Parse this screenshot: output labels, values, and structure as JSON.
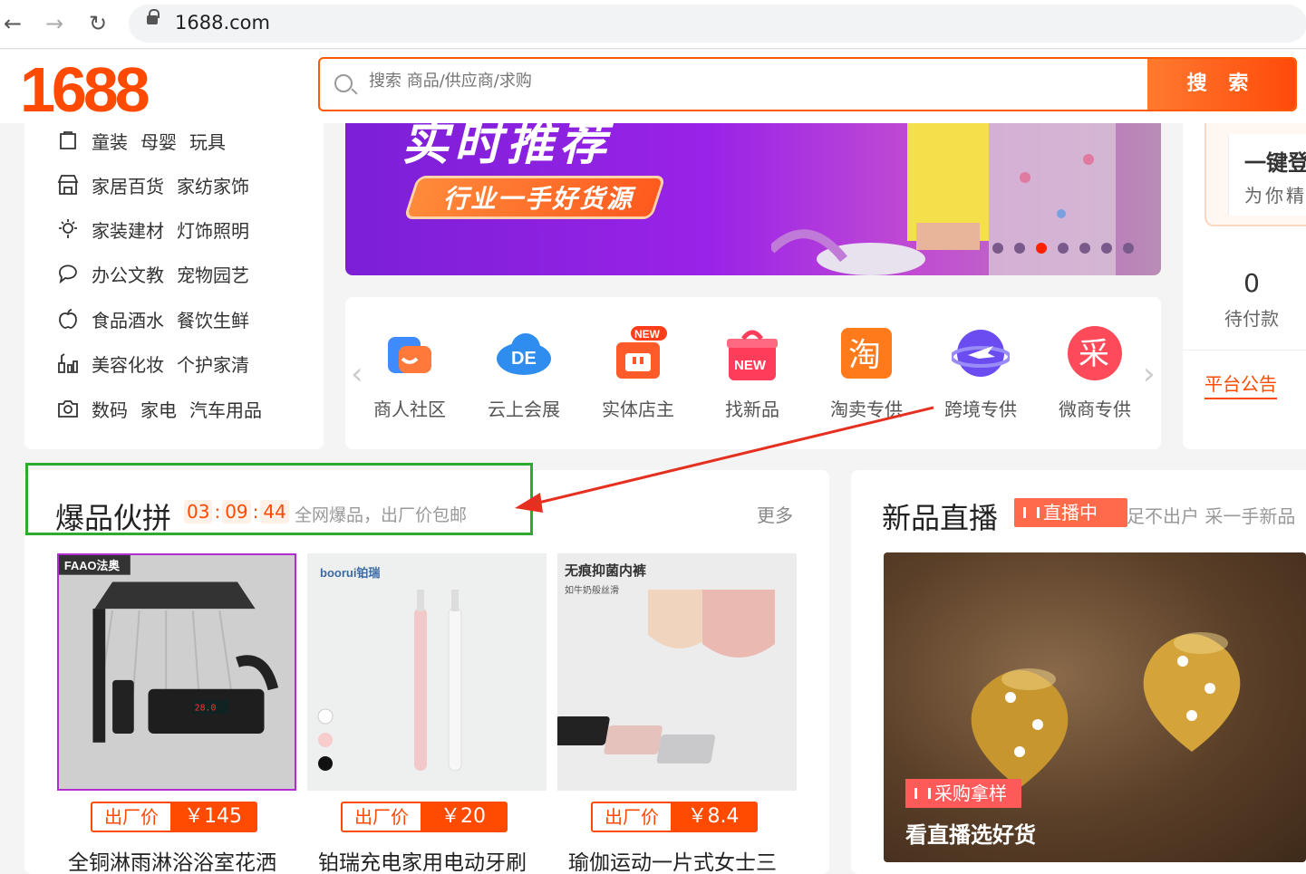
{
  "browser": {
    "url": "1688.com"
  },
  "header": {
    "logo": "1688",
    "search_placeholder": "搜索 商品/供应商/求购",
    "search_button": "搜 索"
  },
  "categories": [
    {
      "icon": "shirt-icon",
      "items": [
        "童装",
        "母婴",
        "玩具"
      ]
    },
    {
      "icon": "store-icon",
      "items": [
        "家居百货",
        "家纺家饰"
      ]
    },
    {
      "icon": "lightbulb-icon",
      "items": [
        "家装建材",
        "灯饰照明"
      ]
    },
    {
      "icon": "chat-icon",
      "items": [
        "办公文教",
        "宠物园艺"
      ]
    },
    {
      "icon": "apple-icon",
      "items": [
        "食品酒水",
        "餐饮生鲜"
      ]
    },
    {
      "icon": "cosmetics-icon",
      "items": [
        "美容化妆",
        "个护家清"
      ]
    },
    {
      "icon": "camera-icon",
      "items": [
        "数码",
        "家电",
        "汽车用品"
      ]
    }
  ],
  "banner": {
    "title": "实时推荐",
    "pill_text": "行业一手好货源",
    "active_dot_index": 2,
    "dot_count": 7
  },
  "services": [
    {
      "label": "商人社区",
      "icon": "community-icon",
      "color": "#3d8bfd"
    },
    {
      "label": "云上会展",
      "icon": "cloud-expo-icon",
      "color": "#2f8df0"
    },
    {
      "label": "实体店主",
      "icon": "shop-owner-icon",
      "color": "#ff5a2a",
      "badge": "NEW"
    },
    {
      "label": "找新品",
      "icon": "new-gift-icon",
      "color": "#ff3d5a",
      "badge": "NEW"
    },
    {
      "label": "淘卖专供",
      "icon": "tao-icon",
      "color": "#ff7a1a",
      "glyph": "淘"
    },
    {
      "label": "跨境专供",
      "icon": "plane-globe-icon",
      "color": "#6a4cf0"
    },
    {
      "label": "微商专供",
      "icon": "cai-icon",
      "color": "#ff4a5a",
      "glyph": "采"
    }
  ],
  "right_panel": {
    "promo_line1": "一键登",
    "promo_line2": "为你精",
    "pending_count": "0",
    "pending_label": "待付款",
    "notice": "平台公告"
  },
  "hot_group": {
    "title": "爆品伙拼",
    "timer": [
      "03",
      "09",
      "44"
    ],
    "subtitle": "全网爆品，出厂价包邮",
    "more": "更多",
    "price_label": "出厂价",
    "products": [
      {
        "title": "全铜淋雨淋浴浴室花洒",
        "price": "￥145",
        "brand": "FAAO法奥"
      },
      {
        "title": "铂瑞充电家用电动牙刷",
        "price": "￥20",
        "brand": "boorui铂瑞"
      },
      {
        "title": "瑜伽运动一片式女士三",
        "price": "￥8.4",
        "brand": "无痕抑菌内裤",
        "brand_sub": "如牛奶般丝滑"
      }
    ]
  },
  "live": {
    "title": "新品直播",
    "badge": "直播中",
    "subtitle": "足不出户 采一手新品",
    "tag": "采购拿样",
    "caption": "看直播选好货"
  }
}
